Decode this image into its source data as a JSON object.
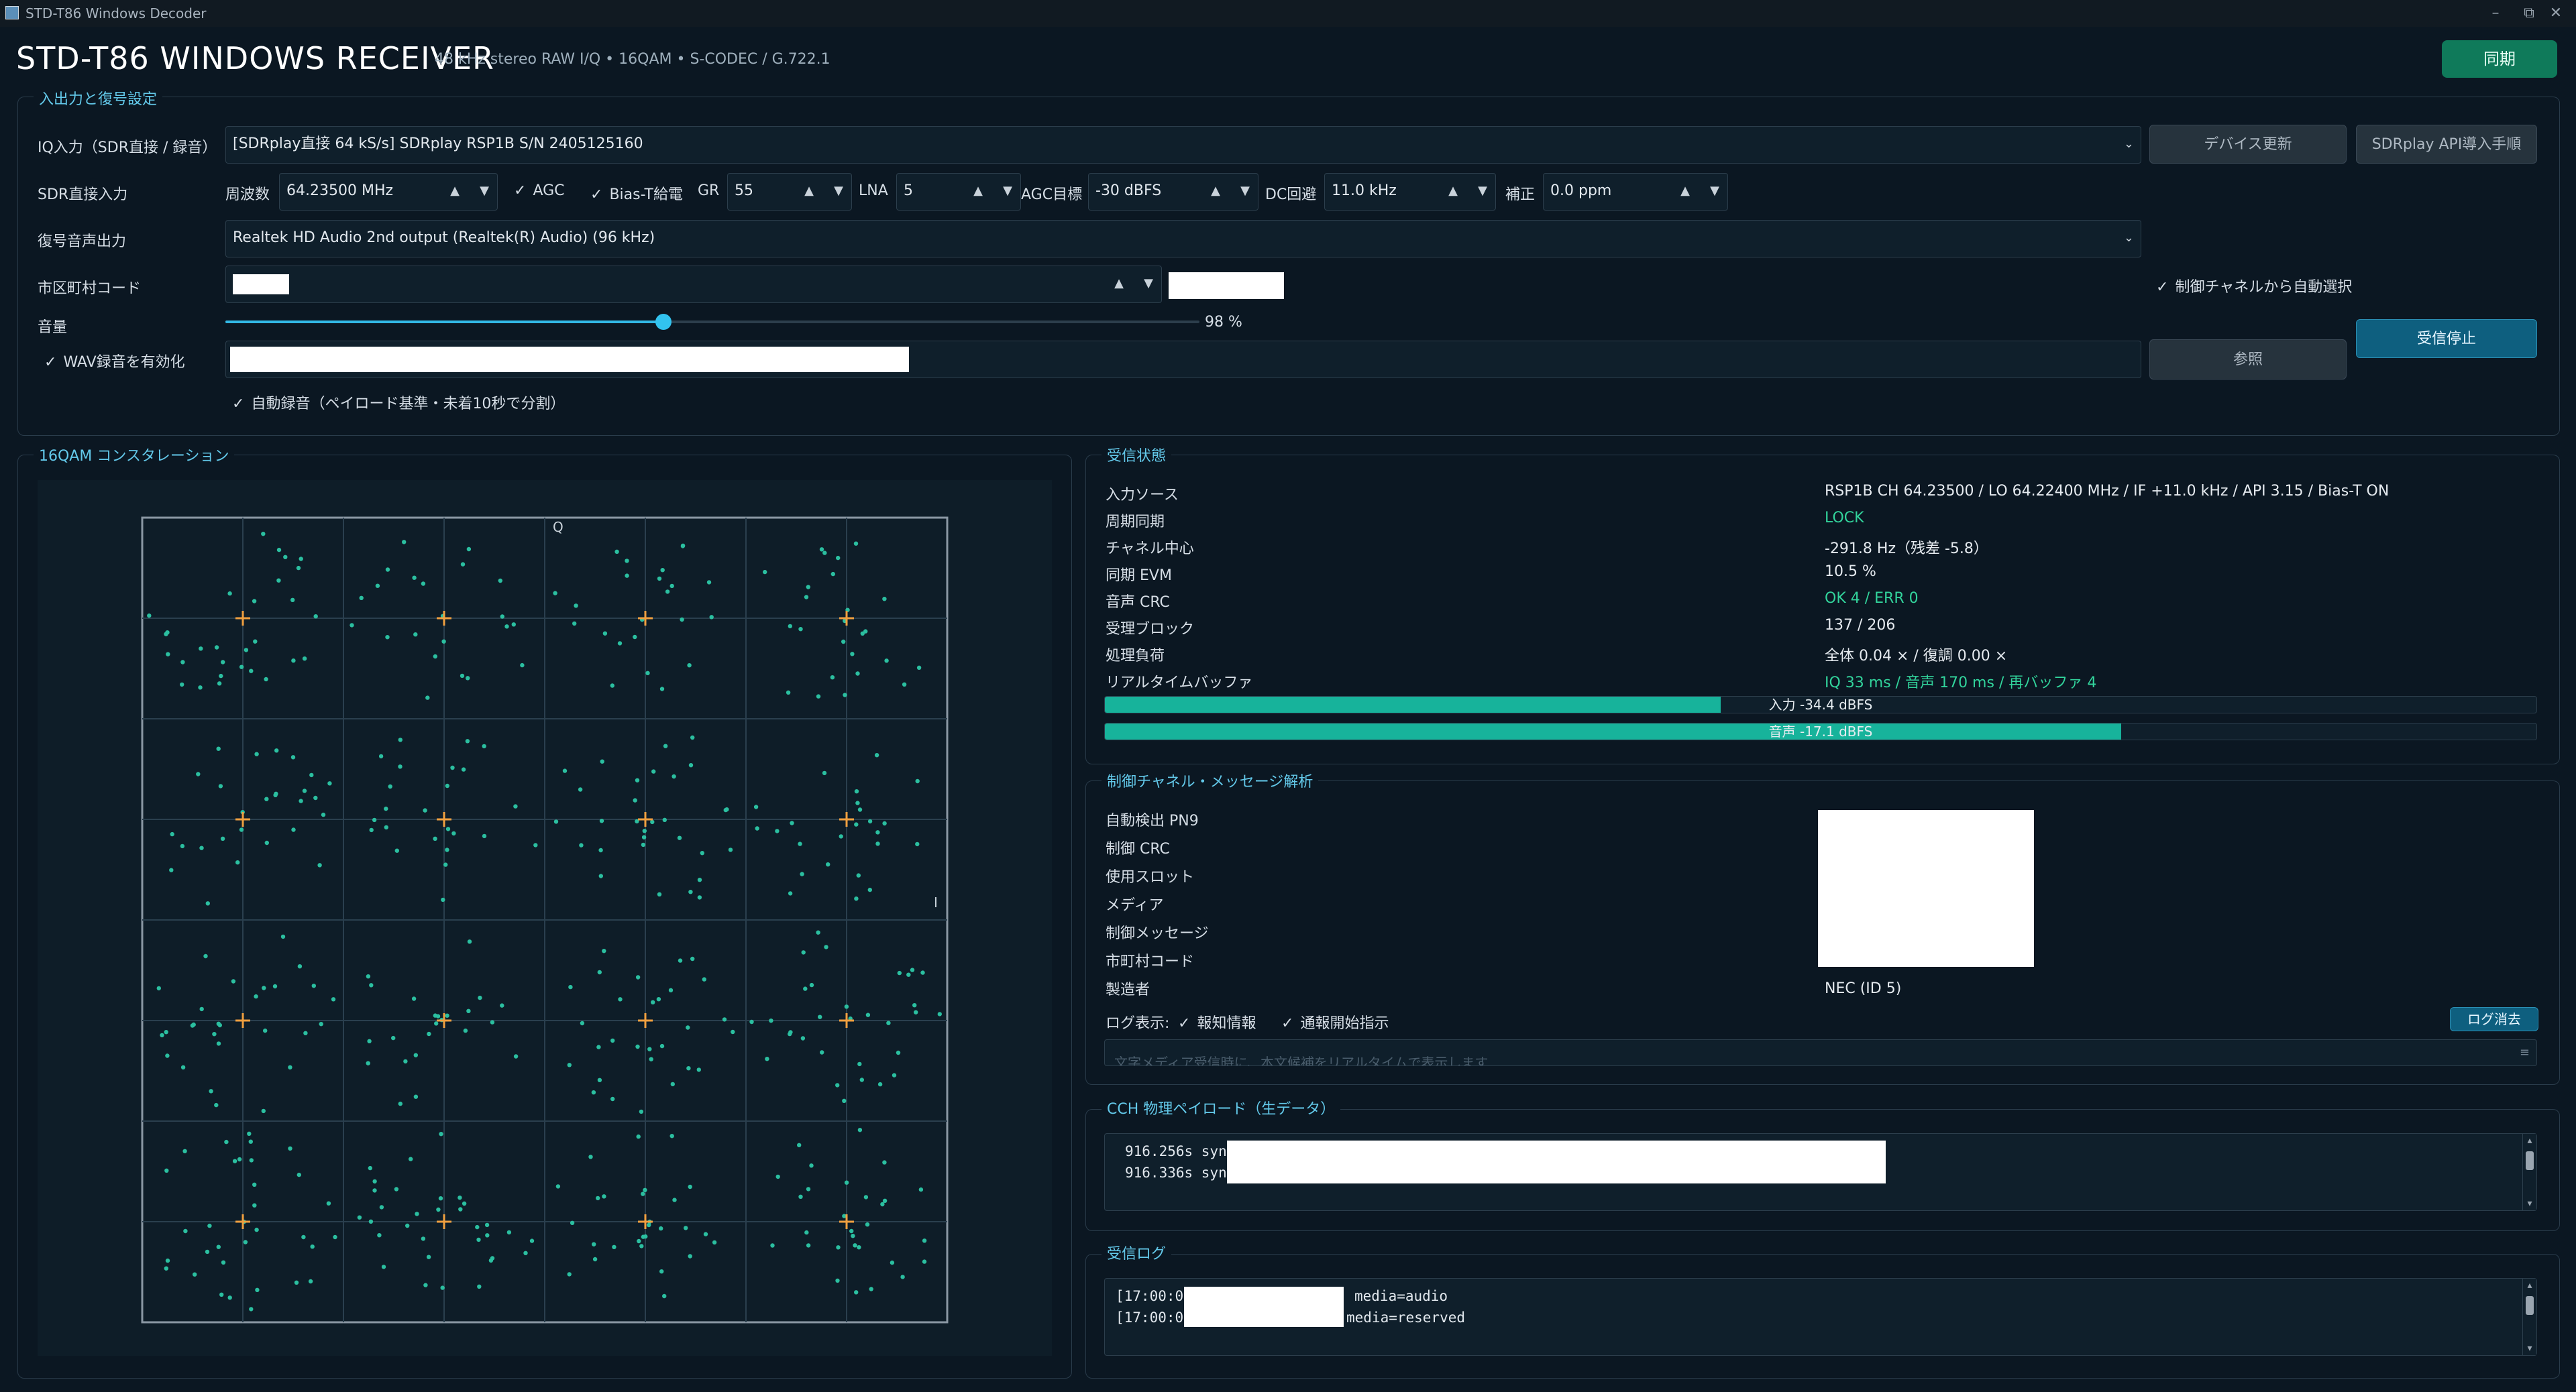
{
  "window": {
    "title": "STD-T86 Windows Decoder",
    "minimize": "–",
    "restore": "⧉",
    "close": "✕"
  },
  "header": {
    "title": "STD-T86  WINDOWS RECEIVER",
    "subtitle": "48 kHz stereo RAW I/Q  •  16QAM  •  S-CODEC / G.722.1",
    "sync_label": "同期"
  },
  "io_panel": {
    "legend": "入出力と復号設定",
    "iq_input_label": "IQ入力（SDR直接 / 録音）",
    "iq_input_value": "[SDRplay直接 64 kS/s] SDRplay RSP1B  S/N 2405125160",
    "refresh_devices_label": "デバイス更新",
    "sdrplay_api_label": "SDRplay API導入手順",
    "sdr_direct_label": "SDR直接入力",
    "freq_label": "周波数",
    "freq_value": "64.23500 MHz",
    "agc_label": "AGC",
    "bias_t_label": "Bias-T給電",
    "gr_label": "GR",
    "gr_value": "55",
    "lna_label": "LNA",
    "lna_value": "5",
    "agc_target_label": "AGC目標",
    "agc_target_value": "-30 dBFS",
    "dc_avoid_label": "DC回避",
    "dc_avoid_value": "11.0 kHz",
    "correction_label": "補正",
    "correction_value": "0.0 ppm",
    "audio_out_label": "復号音声出力",
    "audio_out_value": "Realtek HD Audio 2nd output (Realtek(R) Audio)  (96 kHz)",
    "municipality_label": "市区町村コード",
    "auto_select_label": "制御チャネルから自動選択",
    "volume_label": "音量",
    "volume_value": "98 %",
    "volume_level": 0.45,
    "wav_enable_label": "WAV録音を有効化",
    "browse_label": "参照",
    "stop_label": "受信停止",
    "auto_record_label": "自動録音（ペイロード基準・未着10秒で分割）",
    "check_mark": "✓",
    "up_arrow": "▲",
    "down_arrow": "▼"
  },
  "constellation": {
    "legend": "16QAM コンスタレーション",
    "q_axis": "Q",
    "i_axis": "I",
    "plus_color": "#f0a040",
    "dot_color": "#2bbfa0"
  },
  "reception": {
    "legend": "受信状態",
    "rows": [
      {
        "label": "入力ソース",
        "value": "RSP1B CH 64.23500 / LO 64.22400 MHz / IF +11.0 kHz / API 3.15 / Bias-T ON",
        "green": false
      },
      {
        "label": "周期同期",
        "value": "LOCK",
        "green": true
      },
      {
        "label": "チャネル中心",
        "value": "-291.8 Hz（残差 -5.8）",
        "green": false
      },
      {
        "label": "同期 EVM",
        "value": "10.5 %",
        "green": false
      },
      {
        "label": "音声 CRC",
        "value": "OK 4 / ERR 0",
        "green": true
      },
      {
        "label": "受理ブロック",
        "value": "137 / 206",
        "green": false
      },
      {
        "label": "処理負荷",
        "value": "全体 0.04 × / 復調 0.00 ×",
        "green": false
      },
      {
        "label": "リアルタイムバッファ",
        "value": "IQ 33 ms / 音声 170 ms / 再バッファ 4",
        "green": true
      }
    ],
    "input_meter_label": "入力  -34.4 dBFS",
    "input_meter_level": 0.43,
    "audio_meter_label": "音声  -17.1 dBFS",
    "audio_meter_level": 0.71
  },
  "control": {
    "legend": "制御チャネル・メッセージ解析",
    "rows": [
      {
        "label": "自動検出 PN9"
      },
      {
        "label": "制御 CRC"
      },
      {
        "label": "使用スロット"
      },
      {
        "label": "メディア"
      },
      {
        "label": "制御メッセージ"
      },
      {
        "label": "市町村コード"
      },
      {
        "label": "製造者"
      }
    ],
    "manufacturer_value": "NEC (ID 5)",
    "log_display_label": "ログ表示:",
    "notice_label": "報知情報",
    "broadcast_start_label": "通報開始指示",
    "clear_log_label": "ログ消去",
    "message_placeholder": "文字メディア受信時に、本文候補をリアルタイムで表示します"
  },
  "cch": {
    "legend": "CCH 物理ペイロード（生データ）",
    "lines": [
      "916.256s  sync=",
      "916.336s  sync="
    ]
  },
  "rxlog": {
    "legend": "受信ログ",
    "lines": [
      {
        "time": "[17:00:07]",
        "text": "media=audio"
      },
      {
        "time": "[17:00:08]",
        "text": "media=reserved"
      }
    ]
  }
}
